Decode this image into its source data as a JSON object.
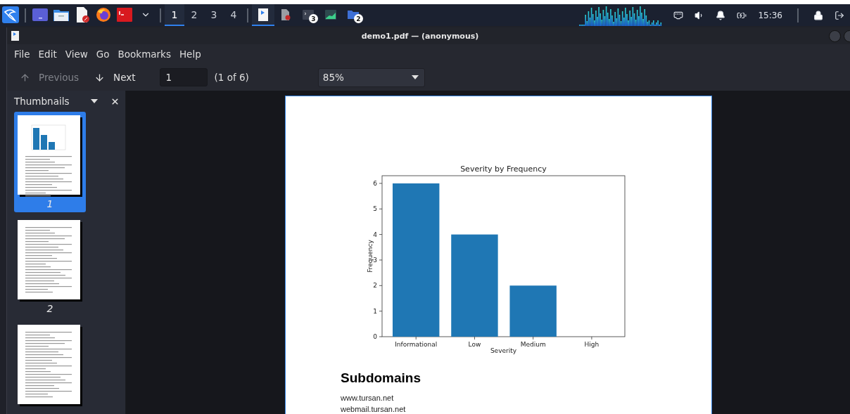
{
  "taskbar": {
    "launchers": [
      {
        "kind": "logo"
      },
      {
        "kind": "terminal-window"
      },
      {
        "kind": "folder"
      },
      {
        "kind": "document"
      },
      {
        "kind": "browser"
      },
      {
        "kind": "red-terminal"
      },
      {
        "kind": "menu"
      }
    ],
    "workspaces": [
      {
        "label": "1",
        "selected": true
      },
      {
        "label": "2",
        "selected": false
      },
      {
        "label": "3",
        "selected": false
      },
      {
        "label": "4",
        "selected": false
      }
    ],
    "tasks": [
      {
        "kind": "viewer",
        "selected": true
      },
      {
        "kind": "document",
        "selected": false
      },
      {
        "kind": "terminal",
        "badge": "3",
        "selected": false
      },
      {
        "kind": "monitor",
        "selected": false
      },
      {
        "kind": "folder",
        "badge": "2",
        "selected": false
      }
    ],
    "clock": "15:36"
  },
  "window": {
    "title": "demo1.pdf — (anonymous)",
    "menu": [
      "File",
      "Edit",
      "View",
      "Go",
      "Bookmarks",
      "Help"
    ],
    "toolbar": {
      "previous": {
        "label": "Previous",
        "disabled": true
      },
      "next": {
        "label": "Next",
        "disabled": false
      },
      "page_field": "1",
      "page_count": "(1 of 6)",
      "zoom": "85%"
    },
    "sidebar": {
      "title": "Thumbnails",
      "thumbnails": [
        {
          "label": "1",
          "selected": true
        },
        {
          "label": "2",
          "selected": false
        },
        {
          "selected": false
        }
      ]
    },
    "document": {
      "chart_data": {
        "type": "bar",
        "title": "Severity by Frequency",
        "xlabel": "Severity",
        "ylabel": "Frequency",
        "categories": [
          "Informational",
          "Low",
          "Medium",
          "High"
        ],
        "series": [
          {
            "color": "#1f77b4",
            "values": [
              6,
              4,
              2,
              0
            ]
          }
        ],
        "ylim": [
          0,
          6.3
        ],
        "yticks": [
          0,
          1,
          2,
          3,
          4,
          5,
          6
        ]
      },
      "heading": "Subdomains",
      "lines": [
        "www.tursan.net",
        "webmail.tursan.net"
      ]
    }
  }
}
